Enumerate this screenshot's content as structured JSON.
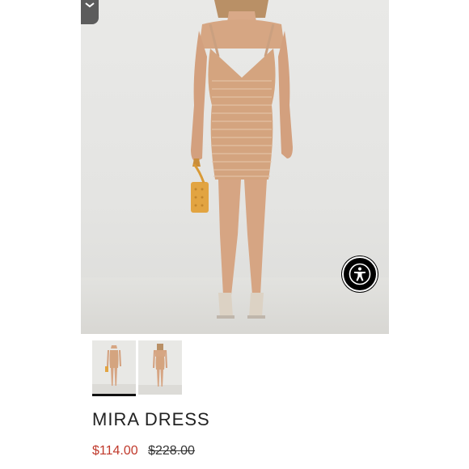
{
  "gallery": {
    "main_image_alt": "Model wearing knit mini dress",
    "thumbnails": [
      {
        "alt": "Front view",
        "selected": true
      },
      {
        "alt": "Back view",
        "selected": false
      }
    ]
  },
  "product": {
    "name": "MIRA DRESS",
    "sale_price": "$114.00",
    "original_price": "$228.00"
  },
  "colors": {
    "sale": "#c0392b",
    "accessibility_button": "#000000",
    "dress": "#d4a47f"
  },
  "icons": {
    "accessibility": "accessibility-person-icon",
    "menu_tab": "chevron-icon"
  }
}
